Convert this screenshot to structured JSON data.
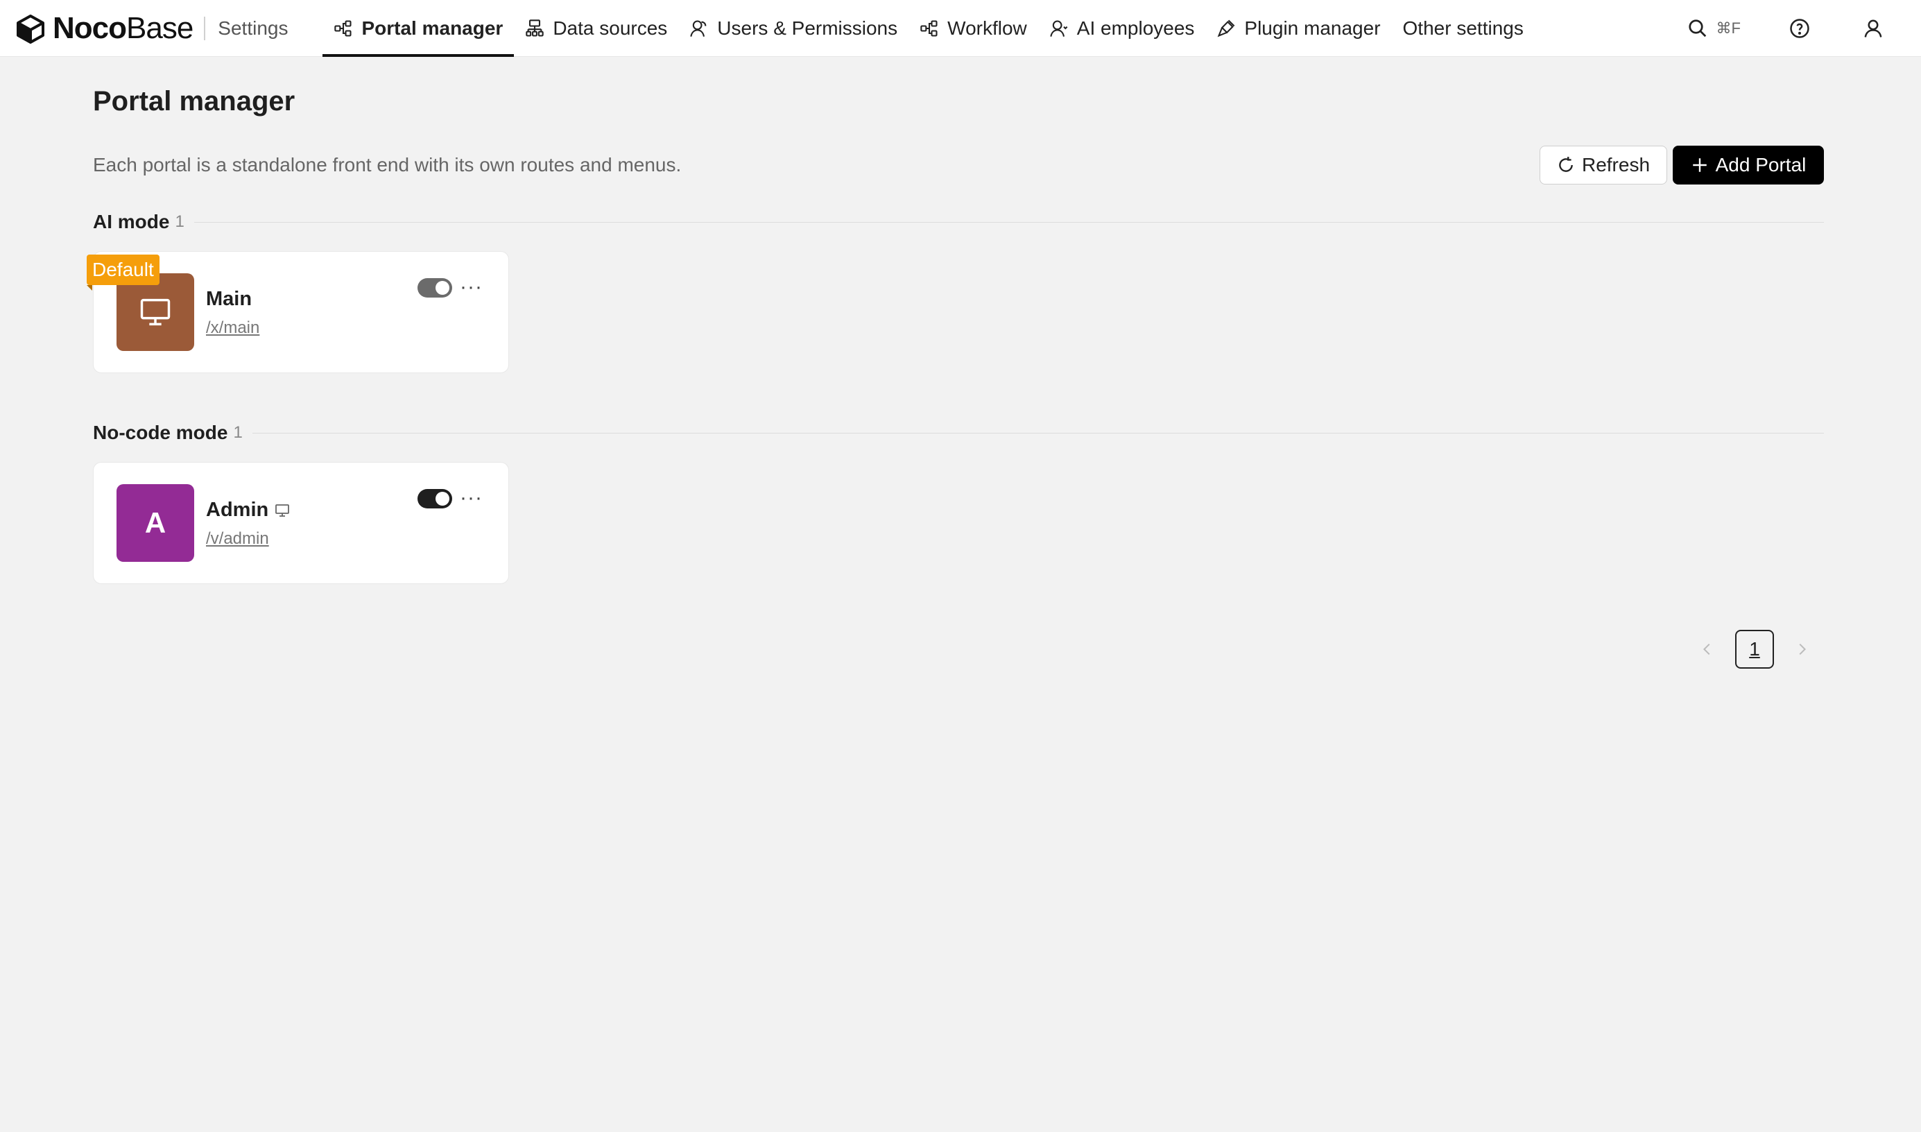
{
  "brand": {
    "name_bold": "Noco",
    "name_light": "Base",
    "section": "Settings"
  },
  "nav": {
    "items": [
      {
        "label": "Portal manager",
        "icon": "portal-icon",
        "active": true
      },
      {
        "label": "Data sources",
        "icon": "data-sources-icon"
      },
      {
        "label": "Users & Permissions",
        "icon": "users-icon"
      },
      {
        "label": "Workflow",
        "icon": "workflow-icon"
      },
      {
        "label": "AI employees",
        "icon": "ai-employee-icon"
      },
      {
        "label": "Plugin manager",
        "icon": "plugin-icon"
      },
      {
        "label": "Other settings"
      }
    ]
  },
  "tools": {
    "search_shortcut": "⌘F"
  },
  "page": {
    "title": "Portal manager",
    "description": "Each portal is a standalone front end with its own routes and menus.",
    "refresh_label": "Refresh",
    "add_label": "Add Portal"
  },
  "sections": [
    {
      "title": "AI mode",
      "count": "1",
      "portal": {
        "name": "Main",
        "path": "/x/main",
        "badge": "Default",
        "color": "#9b5a38",
        "enabled": true,
        "toggle_color": "#6b6b6b"
      }
    },
    {
      "title": "No-code mode",
      "count": "1",
      "portal": {
        "name": "Admin",
        "initial": "A",
        "path": "/v/admin",
        "color": "#932b95",
        "enabled": true,
        "toggle_color": "#1f1f1f"
      }
    }
  ],
  "pagination": {
    "current": "1"
  }
}
